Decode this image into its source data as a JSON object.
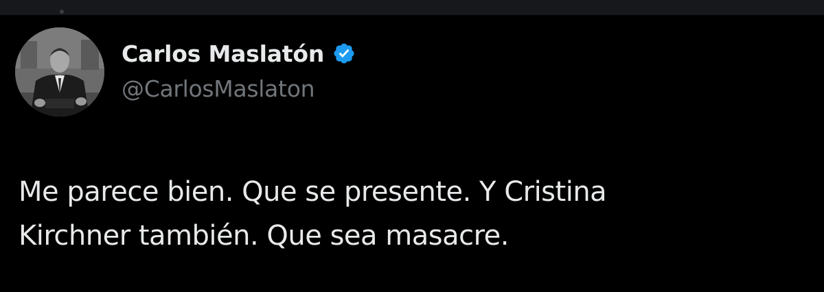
{
  "tweet": {
    "author": {
      "display_name": "Carlos Maslatón",
      "handle": "@CarlosMaslaton",
      "verified": true,
      "verified_icon": "verified-badge-icon"
    },
    "text_lines": [
      "Me parece bien. Que se presente. Y Cristina",
      "Kirchner también. Que sea masacre."
    ]
  },
  "colors": {
    "background": "#000000",
    "text": "#e7e9ea",
    "secondary_text": "#71767b",
    "verified_blue": "#1d9bf0"
  }
}
